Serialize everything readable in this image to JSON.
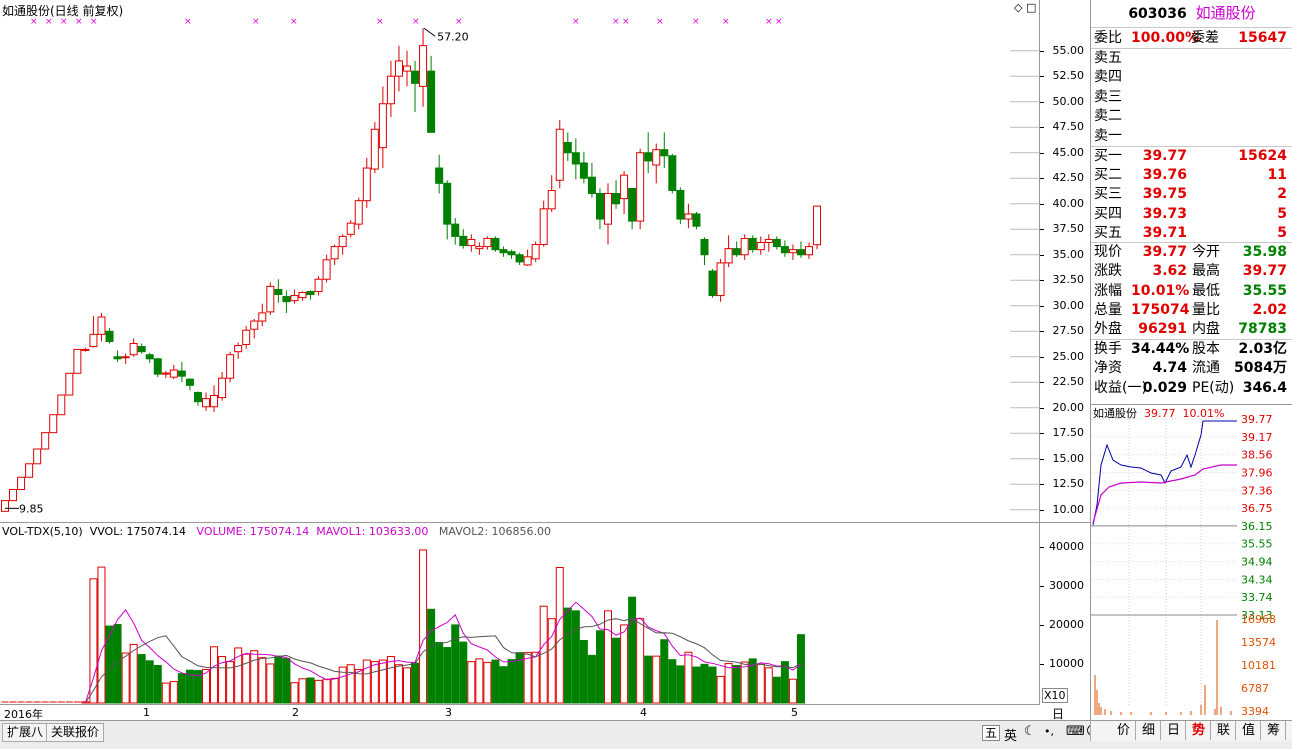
{
  "main_chart": {
    "title": "如通股份(日线 前复权)",
    "high_marker": "57.20",
    "low_marker": "9.85",
    "price_ticks": [
      "55.00",
      "52.50",
      "50.00",
      "47.50",
      "45.00",
      "42.50",
      "40.00",
      "37.50",
      "35.00",
      "32.50",
      "30.00",
      "27.50",
      "25.00",
      "22.50",
      "20.00",
      "17.50",
      "15.00",
      "12.50",
      "10.00"
    ],
    "ylim": [
      9.0,
      58.5
    ]
  },
  "volume_chart": {
    "indicator": "VOL-TDX(5,10)",
    "vvol": "VVOL: 175074.14",
    "volume": "VOLUME: 175074.14",
    "mavol1": "MAVOL1: 103633.00",
    "mavol2": "MAVOL2: 106856.00",
    "ticks": [
      "40000",
      "30000",
      "20000",
      "10000"
    ],
    "unit": "X10"
  },
  "date_axis": {
    "year": "2016年",
    "months": [
      "1",
      "2",
      "3",
      "4",
      "5"
    ],
    "period": "日线"
  },
  "quote": {
    "code": "603036",
    "name": "如通股份",
    "weibi_label": "委比",
    "weibi": "100.00%",
    "weicha_label": "委差",
    "weicha": "15647",
    "sell": [
      {
        "label": "卖五",
        "price": "",
        "vol": ""
      },
      {
        "label": "卖四",
        "price": "",
        "vol": ""
      },
      {
        "label": "卖三",
        "price": "",
        "vol": ""
      },
      {
        "label": "卖二",
        "price": "",
        "vol": ""
      },
      {
        "label": "卖一",
        "price": "",
        "vol": ""
      }
    ],
    "buy": [
      {
        "label": "买一",
        "price": "39.77",
        "vol": "15624"
      },
      {
        "label": "买二",
        "price": "39.76",
        "vol": "11"
      },
      {
        "label": "买三",
        "price": "39.75",
        "vol": "2"
      },
      {
        "label": "买四",
        "price": "39.73",
        "vol": "5"
      },
      {
        "label": "买五",
        "price": "39.71",
        "vol": "5"
      }
    ],
    "stats": [
      {
        "l1": "现价",
        "v1": "39.77",
        "c1": "red",
        "l2": "今开",
        "v2": "35.98",
        "c2": "green"
      },
      {
        "l1": "涨跌",
        "v1": "3.62",
        "c1": "red",
        "l2": "最高",
        "v2": "39.77",
        "c2": "red"
      },
      {
        "l1": "涨幅",
        "v1": "10.01%",
        "c1": "red",
        "l2": "最低",
        "v2": "35.55",
        "c2": "green"
      },
      {
        "l1": "总量",
        "v1": "175074",
        "c1": "red",
        "l2": "量比",
        "v2": "2.02",
        "c2": "red"
      },
      {
        "l1": "外盘",
        "v1": "96291",
        "c1": "red",
        "l2": "内盘",
        "v2": "78783",
        "c2": "green"
      }
    ],
    "fund": [
      {
        "l1": "换手",
        "v1": "34.44%",
        "l2": "股本",
        "v2": "2.03亿"
      },
      {
        "l1": "净资",
        "v1": "4.74",
        "l2": "流通",
        "v2": "5084万"
      },
      {
        "l1": "收益(一)",
        "v1": "0.029",
        "l2": "PE(动)",
        "v2": "346.4"
      }
    ]
  },
  "mini_chart": {
    "name": "如通股份",
    "price": "39.77",
    "pct": "10.01%",
    "price_ticks": [
      "39.77",
      "39.17",
      "38.56",
      "37.96",
      "37.36",
      "36.75",
      "36.15",
      "35.55",
      "34.94",
      "34.34",
      "33.74",
      "33.13"
    ],
    "vol_ticks": [
      "16968",
      "13574",
      "10181",
      "6787",
      "3394"
    ]
  },
  "side_tabs": [
    "价",
    "细",
    "日",
    "势",
    "联",
    "值",
    "筹"
  ],
  "bottom_tabs": [
    "扩展八",
    "关联报价"
  ],
  "tray_icons": [
    "五",
    "英"
  ],
  "colors": {
    "up": "#e00000",
    "down": "#008000",
    "ma1": "#cc00cc",
    "ma2": "#555555",
    "bg": "#ffffff"
  },
  "chart_data": {
    "type": "candlestick",
    "title": "如通股份(日线 前复权)",
    "ylim": [
      9.0,
      58.5
    ],
    "note_markers": [],
    "ohlc": [
      [
        9.85,
        10.9,
        9.85,
        10.9
      ],
      [
        10.9,
        11.99,
        10.9,
        11.99
      ],
      [
        11.99,
        13.19,
        11.99,
        13.19
      ],
      [
        13.19,
        14.51,
        13.19,
        14.51
      ],
      [
        14.51,
        15.96,
        14.51,
        15.96
      ],
      [
        15.96,
        17.56,
        15.96,
        17.56
      ],
      [
        17.56,
        19.32,
        17.56,
        19.32
      ],
      [
        19.32,
        21.25,
        19.32,
        21.25
      ],
      [
        21.25,
        23.38,
        21.25,
        23.38
      ],
      [
        23.38,
        25.72,
        23.38,
        25.72
      ],
      [
        25.72,
        25.9,
        25.5,
        25.72
      ],
      [
        26.0,
        29.0,
        25.9,
        27.2
      ],
      [
        27.2,
        29.3,
        26.5,
        28.9
      ],
      [
        27.5,
        27.8,
        26.3,
        26.5
      ],
      [
        25.0,
        25.6,
        24.5,
        24.8
      ],
      [
        25.0,
        25.3,
        24.3,
        25.0
      ],
      [
        25.2,
        26.8,
        25.0,
        26.3
      ],
      [
        26.0,
        26.3,
        25.3,
        25.5
      ],
      [
        25.2,
        25.4,
        24.4,
        24.8
      ],
      [
        24.8,
        24.9,
        23.0,
        23.3
      ],
      [
        23.3,
        23.6,
        22.9,
        23.4
      ],
      [
        23.0,
        24.2,
        22.8,
        23.7
      ],
      [
        23.6,
        24.5,
        22.5,
        23.1
      ],
      [
        22.8,
        22.9,
        21.7,
        22.2
      ],
      [
        21.5,
        21.6,
        20.2,
        20.6
      ],
      [
        20.1,
        21.5,
        19.7,
        20.9
      ],
      [
        20.1,
        22.2,
        19.6,
        21.2
      ],
      [
        21.0,
        23.5,
        20.7,
        22.9
      ],
      [
        22.9,
        25.5,
        22.5,
        25.2
      ],
      [
        25.5,
        26.4,
        24.8,
        26.1
      ],
      [
        26.2,
        28.0,
        25.8,
        27.6
      ],
      [
        27.7,
        28.7,
        26.8,
        28.5
      ],
      [
        28.5,
        30.2,
        28.0,
        29.3
      ],
      [
        29.4,
        32.3,
        29.1,
        31.9
      ],
      [
        31.6,
        32.6,
        30.3,
        31.1
      ],
      [
        30.9,
        31.5,
        29.3,
        30.4
      ],
      [
        30.5,
        31.6,
        30.2,
        31.0
      ],
      [
        30.8,
        31.4,
        30.5,
        31.3
      ],
      [
        31.4,
        31.5,
        30.6,
        31.1
      ],
      [
        31.4,
        32.9,
        31.0,
        32.6
      ],
      [
        32.6,
        35.0,
        32.3,
        34.5
      ],
      [
        34.6,
        36.0,
        34.0,
        35.8
      ],
      [
        35.8,
        37.0,
        35.0,
        36.8
      ],
      [
        37.0,
        38.4,
        36.7,
        38.1
      ],
      [
        38.0,
        40.6,
        37.5,
        40.3
      ],
      [
        40.3,
        44.5,
        39.6,
        43.5
      ],
      [
        43.4,
        48.0,
        43.0,
        47.3
      ],
      [
        45.5,
        51.5,
        43.5,
        49.8
      ],
      [
        49.8,
        54.0,
        48.5,
        52.5
      ],
      [
        52.5,
        55.5,
        51.0,
        54.0
      ],
      [
        53.0,
        55.0,
        51.5,
        53.5
      ],
      [
        53.0,
        54.0,
        49.0,
        51.8
      ],
      [
        51.5,
        57.2,
        49.5,
        55.5
      ],
      [
        53.0,
        54.5,
        48.5,
        47.0
      ],
      [
        43.5,
        44.8,
        41.0,
        42.0
      ],
      [
        42.0,
        42.3,
        36.5,
        38.0
      ],
      [
        38.0,
        38.6,
        36.0,
        36.8
      ],
      [
        36.8,
        37.5,
        35.6,
        35.9
      ],
      [
        35.9,
        37.0,
        35.3,
        36.5
      ],
      [
        35.6,
        36.2,
        35.0,
        35.8
      ],
      [
        35.8,
        36.8,
        35.5,
        36.6
      ],
      [
        36.6,
        36.8,
        35.3,
        35.5
      ],
      [
        35.5,
        35.8,
        34.8,
        35.2
      ],
      [
        35.3,
        35.5,
        34.6,
        35.0
      ],
      [
        35.0,
        35.2,
        34.0,
        34.3
      ],
      [
        34.0,
        35.5,
        33.9,
        34.8
      ],
      [
        34.6,
        36.3,
        34.3,
        36.0
      ],
      [
        36.0,
        40.3,
        35.8,
        39.5
      ],
      [
        39.5,
        42.8,
        39.2,
        41.3
      ],
      [
        42.3,
        48.2,
        41.5,
        47.3
      ],
      [
        46.0,
        47.0,
        44.2,
        45.0
      ],
      [
        45.0,
        46.4,
        42.4,
        43.9
      ],
      [
        44.0,
        45.1,
        42.0,
        42.5
      ],
      [
        42.6,
        44.0,
        40.6,
        41.0
      ],
      [
        41.0,
        41.5,
        37.5,
        38.5
      ],
      [
        38.0,
        42.0,
        36.0,
        41.0
      ],
      [
        41.0,
        42.3,
        39.5,
        40.0
      ],
      [
        40.5,
        43.2,
        39.0,
        42.8
      ],
      [
        41.5,
        41.5,
        37.5,
        38.3
      ],
      [
        38.3,
        45.4,
        37.5,
        45.0
      ],
      [
        45.0,
        47.0,
        43.0,
        44.2
      ],
      [
        43.8,
        45.9,
        42.0,
        45.3
      ],
      [
        45.3,
        47.0,
        43.5,
        44.7
      ],
      [
        44.7,
        44.9,
        41.0,
        41.3
      ],
      [
        41.3,
        41.6,
        38.0,
        38.5
      ],
      [
        38.5,
        40.0,
        37.6,
        39.0
      ],
      [
        39.0,
        39.2,
        37.5,
        37.8
      ],
      [
        36.5,
        36.7,
        34.0,
        35.0
      ],
      [
        33.4,
        33.6,
        30.8,
        31.0
      ],
      [
        31.0,
        34.6,
        30.4,
        34.2
      ],
      [
        34.2,
        36.9,
        33.8,
        35.6
      ],
      [
        35.6,
        36.3,
        34.8,
        35.0
      ],
      [
        35.0,
        37.0,
        34.5,
        36.6
      ],
      [
        36.6,
        36.9,
        35.2,
        35.5
      ],
      [
        35.5,
        36.8,
        35.0,
        36.2
      ],
      [
        36.2,
        37.0,
        35.3,
        36.5
      ],
      [
        36.5,
        36.8,
        35.5,
        35.8
      ],
      [
        35.8,
        36.4,
        34.8,
        35.2
      ],
      [
        35.2,
        36.0,
        34.5,
        35.5
      ],
      [
        35.5,
        36.3,
        34.7,
        35.0
      ],
      [
        35.0,
        36.2,
        34.6,
        35.8
      ],
      [
        35.98,
        39.77,
        35.55,
        39.77
      ]
    ],
    "volume": [
      0,
      0,
      0,
      0,
      0,
      0,
      0,
      0,
      0,
      0,
      300,
      31800,
      34800,
      19700,
      20100,
      12800,
      15000,
      12400,
      10800,
      9600,
      5100,
      5500,
      7500,
      8400,
      8300,
      8600,
      14400,
      11900,
      10600,
      14100,
      12500,
      13400,
      11600,
      10000,
      12000,
      11400,
      5200,
      6200,
      6400,
      5800,
      6100,
      6300,
      9200,
      9800,
      8600,
      11000,
      10600,
      11000,
      11900,
      9800,
      9000,
      10200,
      39200,
      24000,
      15500,
      14200,
      20000,
      15600,
      10600,
      11300,
      10400,
      11000,
      9300,
      11100,
      12900,
      12900,
      13000,
      24800,
      21600,
      34700,
      24300,
      23600,
      16000,
      12200,
      18500,
      23600,
      16600,
      20000,
      27100,
      21600,
      12000,
      12000,
      16200,
      11100,
      9500,
      13000,
      9200,
      9900,
      9200,
      6800,
      10100,
      9600,
      10500,
      11300,
      9900,
      9000,
      6600,
      10600,
      6100,
      17500
    ]
  }
}
